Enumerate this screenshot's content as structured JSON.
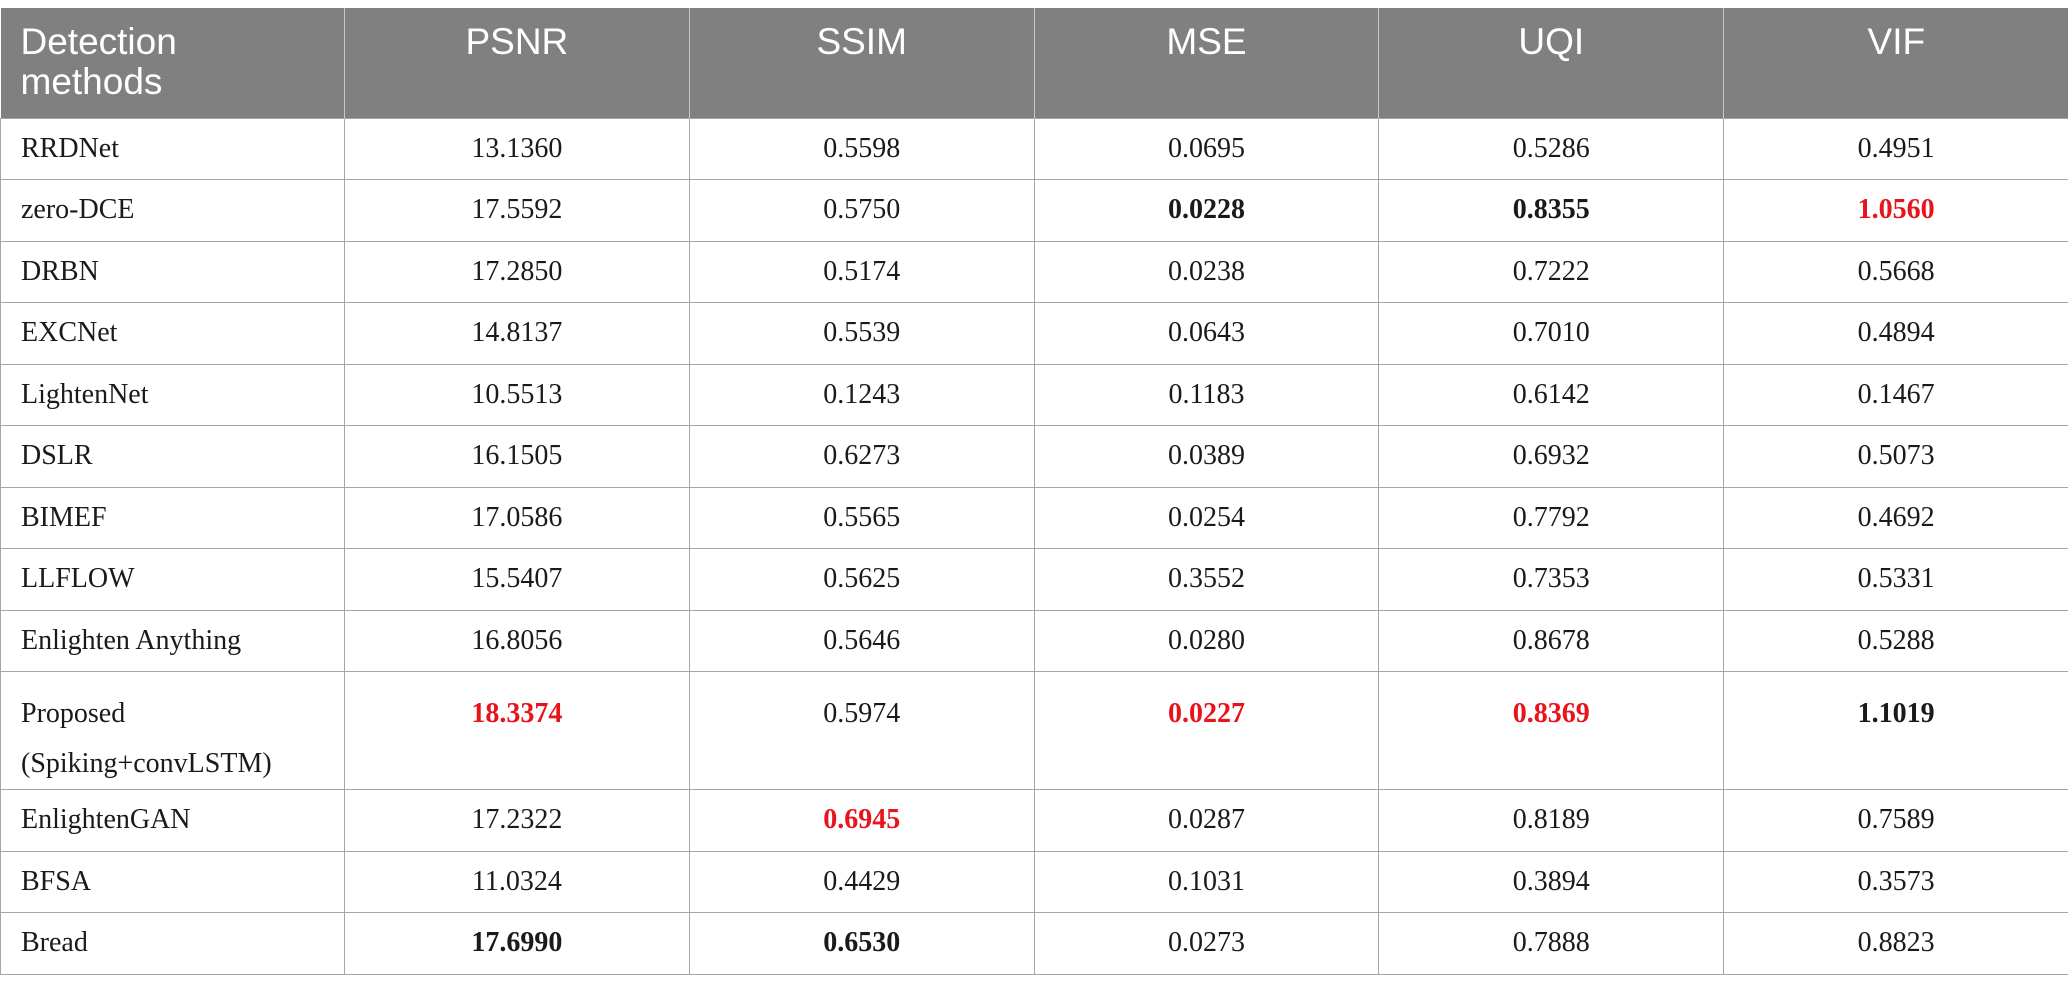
{
  "table": {
    "headers": [
      "Detection methods",
      "PSNR",
      "SSIM",
      "MSE",
      "UQI",
      "VIF"
    ],
    "rows": [
      {
        "cells": [
          "RRDNet",
          "13.1360",
          "0.5598",
          "0.0695",
          "0.5286",
          "0.4951"
        ],
        "styles": [
          "",
          "",
          "",
          "",
          "",
          ""
        ]
      },
      {
        "cells": [
          "zero-DCE",
          "17.5592",
          "0.5750",
          "0.0228",
          "0.8355",
          "1.0560"
        ],
        "styles": [
          "",
          "",
          "",
          "bold",
          "bold",
          "red"
        ]
      },
      {
        "cells": [
          "DRBN",
          "17.2850",
          "0.5174",
          "0.0238",
          "0.7222",
          "0.5668"
        ],
        "styles": [
          "",
          "",
          "",
          "",
          "",
          ""
        ]
      },
      {
        "cells": [
          "EXCNet",
          "14.8137",
          "0.5539",
          "0.0643",
          "0.7010",
          "0.4894"
        ],
        "styles": [
          "",
          "",
          "",
          "",
          "",
          ""
        ]
      },
      {
        "cells": [
          "LightenNet",
          "10.5513",
          "0.1243",
          "0.1183",
          "0.6142",
          "0.1467"
        ],
        "styles": [
          "",
          "",
          "",
          "",
          "",
          ""
        ]
      },
      {
        "cells": [
          "DSLR",
          "16.1505",
          "0.6273",
          "0.0389",
          "0.6932",
          "0.5073"
        ],
        "styles": [
          "",
          "",
          "",
          "",
          "",
          ""
        ]
      },
      {
        "cells": [
          "BIMEF",
          "17.0586",
          "0.5565",
          "0.0254",
          "0.7792",
          "0.4692"
        ],
        "styles": [
          "",
          "",
          "",
          "",
          "",
          ""
        ]
      },
      {
        "cells": [
          "LLFLOW",
          "15.5407",
          "0.5625",
          "0.3552",
          "0.7353",
          "0.5331"
        ],
        "styles": [
          "",
          "",
          "",
          "",
          "",
          ""
        ]
      },
      {
        "cells": [
          "Enlighten Anything",
          "16.8056",
          "0.5646",
          "0.0280",
          "0.8678",
          "0.5288"
        ],
        "styles": [
          "",
          "",
          "",
          "",
          "",
          ""
        ]
      },
      {
        "cells": [
          "Proposed (Spiking+convLSTM)",
          "18.3374",
          "0.5974",
          "0.0227",
          "0.8369",
          "1.1019"
        ],
        "styles": [
          "",
          "red",
          "",
          "red",
          "red",
          "bold"
        ],
        "tall": true
      },
      {
        "cells": [
          "EnlightenGAN",
          "17.2322",
          "0.6945",
          "0.0287",
          "0.8189",
          "0.7589"
        ],
        "styles": [
          "",
          "",
          "red",
          "",
          "",
          ""
        ]
      },
      {
        "cells": [
          "BFSA",
          "11.0324",
          "0.4429",
          "0.1031",
          "0.3894",
          "0.3573"
        ],
        "styles": [
          "",
          "",
          "",
          "",
          "",
          ""
        ]
      },
      {
        "cells": [
          "Bread",
          "17.6990",
          "0.6530",
          "0.0273",
          "0.7888",
          "0.8823"
        ],
        "styles": [
          "",
          "bold",
          "bold",
          "",
          "",
          ""
        ]
      }
    ]
  }
}
